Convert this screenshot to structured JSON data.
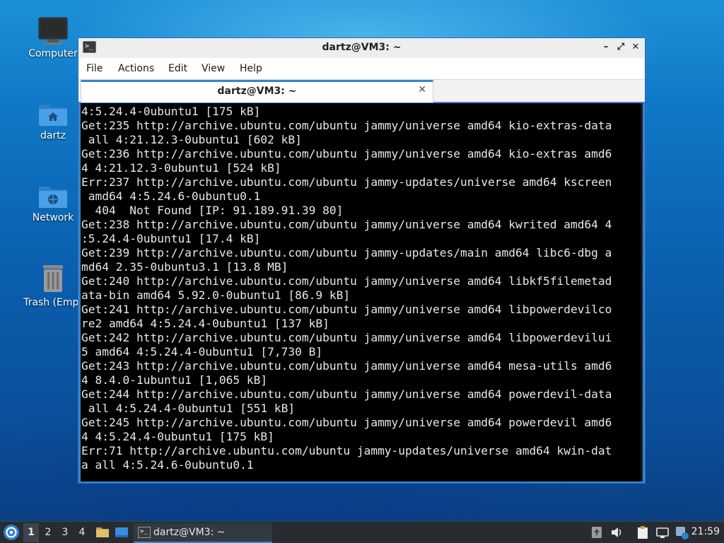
{
  "desktop": {
    "icons": [
      {
        "label": "Computer",
        "icon": "computer-icon"
      },
      {
        "label": "dartz",
        "icon": "home-folder-icon"
      },
      {
        "label": "Network",
        "icon": "network-folder-icon"
      },
      {
        "label": "Trash (Empt",
        "icon": "trash-icon"
      }
    ]
  },
  "window": {
    "title": "dartz@VM3: ~",
    "buttons": {
      "minimize": "–",
      "maximize": "⤢",
      "close": "✕"
    },
    "menu": [
      "File",
      "Actions",
      "Edit",
      "View",
      "Help"
    ],
    "tab": {
      "label": "dartz@VM3: ~",
      "close": "✕"
    },
    "terminal_lines": [
      "4:5.24.4-0ubuntu1 [175 kB]",
      "Get:235 http://archive.ubuntu.com/ubuntu jammy/universe amd64 kio-extras-data",
      " all 4:21.12.3-0ubuntu1 [602 kB]",
      "Get:236 http://archive.ubuntu.com/ubuntu jammy/universe amd64 kio-extras amd6",
      "4 4:21.12.3-0ubuntu1 [524 kB]",
      "Err:237 http://archive.ubuntu.com/ubuntu jammy-updates/universe amd64 kscreen",
      " amd64 4:5.24.6-0ubuntu0.1",
      "  404  Not Found [IP: 91.189.91.39 80]",
      "Get:238 http://archive.ubuntu.com/ubuntu jammy/universe amd64 kwrited amd64 4",
      ":5.24.4-0ubuntu1 [17.4 kB]",
      "Get:239 http://archive.ubuntu.com/ubuntu jammy-updates/main amd64 libc6-dbg a",
      "md64 2.35-0ubuntu3.1 [13.8 MB]",
      "Get:240 http://archive.ubuntu.com/ubuntu jammy/universe amd64 libkf5filemetad",
      "ata-bin amd64 5.92.0-0ubuntu1 [86.9 kB]",
      "Get:241 http://archive.ubuntu.com/ubuntu jammy/universe amd64 libpowerdevilco",
      "re2 amd64 4:5.24.4-0ubuntu1 [137 kB]",
      "Get:242 http://archive.ubuntu.com/ubuntu jammy/universe amd64 libpowerdevilui",
      "5 amd64 4:5.24.4-0ubuntu1 [7,730 B]",
      "Get:243 http://archive.ubuntu.com/ubuntu jammy/universe amd64 mesa-utils amd6",
      "4 8.4.0-1ubuntu1 [1,065 kB]",
      "Get:244 http://archive.ubuntu.com/ubuntu jammy/universe amd64 powerdevil-data",
      " all 4:5.24.4-0ubuntu1 [551 kB]",
      "Get:245 http://archive.ubuntu.com/ubuntu jammy/universe amd64 powerdevil amd6",
      "4 4:5.24.4-0ubuntu1 [175 kB]",
      "Err:71 http://archive.ubuntu.com/ubuntu jammy-updates/universe amd64 kwin-dat",
      "a all 4:5.24.6-0ubuntu0.1"
    ]
  },
  "taskbar": {
    "workspaces": [
      "1",
      "2",
      "3",
      "4"
    ],
    "active_workspace": "1",
    "task_label": "dartz@VM3: ~",
    "clock": "21:59",
    "accent": "#3a83d0"
  }
}
